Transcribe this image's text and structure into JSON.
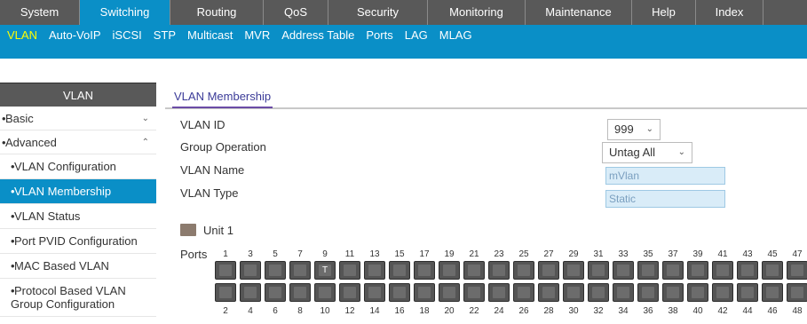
{
  "top_nav": [
    {
      "label": "System",
      "active": false
    },
    {
      "label": "Switching",
      "active": true
    },
    {
      "label": "Routing",
      "active": false
    },
    {
      "label": "QoS",
      "active": false
    },
    {
      "label": "Security",
      "active": false
    },
    {
      "label": "Monitoring",
      "active": false
    },
    {
      "label": "Maintenance",
      "active": false
    },
    {
      "label": "Help",
      "active": false
    },
    {
      "label": "Index",
      "active": false
    }
  ],
  "sub_nav": [
    {
      "label": "VLAN",
      "active": true
    },
    {
      "label": "Auto-VoIP",
      "active": false
    },
    {
      "label": "iSCSI",
      "active": false
    },
    {
      "label": "STP",
      "active": false
    },
    {
      "label": "Multicast",
      "active": false
    },
    {
      "label": "MVR",
      "active": false
    },
    {
      "label": "Address Table",
      "active": false
    },
    {
      "label": "Ports",
      "active": false
    },
    {
      "label": "LAG",
      "active": false
    },
    {
      "label": "MLAG",
      "active": false
    }
  ],
  "sidebar": {
    "title": "VLAN",
    "groups": [
      {
        "label": "Basic",
        "expanded": false
      },
      {
        "label": "Advanced",
        "expanded": true
      }
    ],
    "items": [
      {
        "label": "VLAN Configuration",
        "active": false
      },
      {
        "label": "VLAN Membership",
        "active": true
      },
      {
        "label": "VLAN Status",
        "active": false
      },
      {
        "label": "Port PVID Configuration",
        "active": false
      },
      {
        "label": "MAC Based VLAN",
        "active": false
      },
      {
        "label": "Protocol Based VLAN Group Configuration",
        "active": false
      }
    ]
  },
  "page": {
    "tab": "VLAN Membership",
    "fields": {
      "vlan_id_label": "VLAN ID",
      "vlan_id_value": "999",
      "group_operation_label": "Group Operation",
      "group_operation_value": "Untag All",
      "vlan_name_label": "VLAN Name",
      "vlan_name_value": "mVlan",
      "vlan_type_label": "VLAN Type",
      "vlan_type_value": "Static"
    },
    "unit_label": "Unit 1",
    "ports_label": "Ports",
    "odd_ports": [
      "1",
      "3",
      "5",
      "7",
      "9",
      "11",
      "13",
      "15",
      "17",
      "19",
      "21",
      "23",
      "25",
      "27",
      "29",
      "31",
      "33",
      "35",
      "37",
      "39",
      "41",
      "43",
      "45",
      "47"
    ],
    "even_ports": [
      "2",
      "4",
      "6",
      "8",
      "10",
      "12",
      "14",
      "16",
      "18",
      "20",
      "22",
      "24",
      "26",
      "28",
      "30",
      "32",
      "34",
      "36",
      "38",
      "40",
      "42",
      "44",
      "46",
      "48"
    ],
    "port_states": {
      "9": "T"
    }
  },
  "colors": {
    "accent": "#0a8fc7",
    "nav_bg": "#595959",
    "active_sub": "#ffff00",
    "input_bg": "#d9ecf8"
  },
  "icons": {
    "dropdown": "chevron-down-icon",
    "collapse": "chevron-up-icon",
    "unit": "switch-unit-icon"
  }
}
